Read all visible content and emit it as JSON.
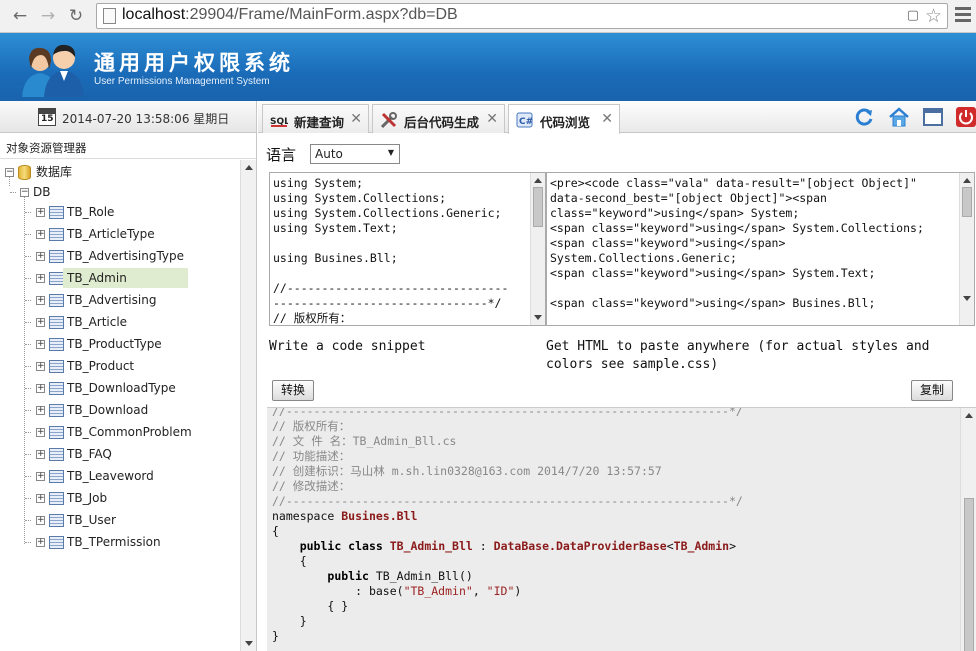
{
  "browser": {
    "url_host": "localhost",
    "url_rest": ":29904/Frame/MainForm.aspx?db=DB"
  },
  "header": {
    "title": "通用用户权限系统",
    "subtitle": "User Permissions Management System"
  },
  "sidebar": {
    "calendar_day": "15",
    "datetime": "2014-07-20 13:58:06 星期日",
    "panel_title": "对象资源管理器",
    "root_label": "数据库",
    "db_label": "DB",
    "tables": [
      "TB_Role",
      "TB_ArticleType",
      "TB_AdvertisingType",
      "TB_Admin",
      "TB_Advertising",
      "TB_Article",
      "TB_ProductType",
      "TB_Product",
      "TB_DownloadType",
      "TB_Download",
      "TB_CommonProblem",
      "TB_FAQ",
      "TB_Leaveword",
      "TB_Job",
      "TB_User",
      "TB_TPermission"
    ],
    "selected": "TB_Admin"
  },
  "tabs": [
    {
      "label": "新建查询",
      "icon": "sql-icon"
    },
    {
      "label": "后台代码生成",
      "icon": "tools-icon"
    },
    {
      "label": "代码浏览",
      "icon": "code-icon"
    }
  ],
  "toolbar": {
    "icons": [
      "refresh-icon",
      "home-icon",
      "window-icon",
      "power-icon"
    ]
  },
  "editor": {
    "language_label": "语言",
    "language_value": "Auto",
    "input_code": "using System;\nusing System.Collections;\nusing System.Collections.Generic;\nusing System.Text;\n\nusing Busines.Bll;\n\n//--------------------------------\n-------------------------------*/\n// 版权所有：",
    "html_code": "<pre><code class=\"vala\" data-result=\"[object Object]\"\ndata-second_best=\"[object Object]\"><span\nclass=\"keyword\">using</span> System;\n<span class=\"keyword\">using</span> System.Collections;\n<span class=\"keyword\">using</span>\nSystem.Collections.Generic;\n<span class=\"keyword\">using</span> System.Text;\n\n<span class=\"keyword\">using</span> Busines.Bll;",
    "caption_left": "Write a code snippet",
    "caption_right": "Get HTML to paste anywhere (for actual styles and\ncolors see sample.css)",
    "convert_label": "转换",
    "copy_label": "复制"
  },
  "output": {
    "lines": [
      "//----------------------------------------------------------------*/",
      "// 版权所有：",
      "// 文 件 名：TB_Admin_Bll.cs",
      "// 功能描述：",
      "// 创建标识：马山林 m.sh.lin0328@163.com 2014/7/20 13:57:57",
      "// 修改描述：",
      "//----------------------------------------------------------------*/"
    ],
    "ns_kw": "namespace",
    "ns_name": "Busines.Bll",
    "brace_open": "{",
    "class_kw": "public class",
    "class_name": "TB_Admin_Bll",
    "colon": ":",
    "base_type": "DataBase.DataProviderBase",
    "generic_open": "<",
    "generic_arg": "TB_Admin",
    "generic_close": ">",
    "inner_open": "{",
    "ctor_kw": "public",
    "ctor_name": "TB_Admin_Bll()",
    "base_call_a": ": base(",
    "base_arg1": "\"TB_Admin\"",
    "comma": ", ",
    "base_arg2": "\"ID\"",
    "base_call_b": ")",
    "empty_body": "{ }",
    "inner_close": "}",
    "brace_close": "}"
  }
}
